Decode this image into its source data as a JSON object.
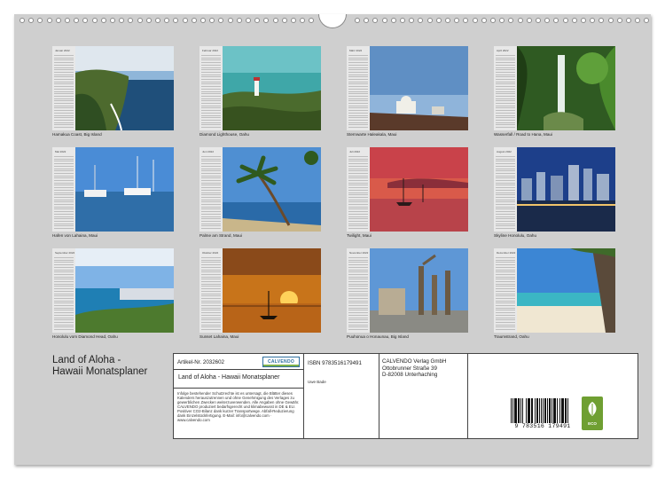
{
  "months": [
    {
      "label": "Januar 2022",
      "caption": "Hamakua Coast, Big Island",
      "scene": "coast"
    },
    {
      "label": "Februar 2022",
      "caption": "Diamond Lighthouse, Oahu",
      "scene": "lighthouse"
    },
    {
      "label": "März 2022",
      "caption": "Sternwarte Haleakala, Maui",
      "scene": "observatory"
    },
    {
      "label": "April 2022",
      "caption": "Wasserfall / Road to Hana, Maui",
      "scene": "waterfall"
    },
    {
      "label": "Mai 2022",
      "caption": "Hafen von Lahaina, Maui",
      "scene": "harbor"
    },
    {
      "label": "Juni 2022",
      "caption": "Palme am Strand, Maui",
      "scene": "palm"
    },
    {
      "label": "Juli 2022",
      "caption": "Twilight, Maui",
      "scene": "twilight"
    },
    {
      "label": "August 2022",
      "caption": "Skyline Honolulu, Oahu",
      "scene": "skyline"
    },
    {
      "label": "September 2022",
      "caption": "Honolulu vom Diamond Head, Oahu",
      "scene": "honolulu"
    },
    {
      "label": "Oktober 2022",
      "caption": "Sunset Lahaina, Maui",
      "scene": "sunset"
    },
    {
      "label": "November 2022",
      "caption": "Puuhonua o Honaunau, Big Island",
      "scene": "tikis"
    },
    {
      "label": "Dezember 2022",
      "caption": "Traumstrand, Oahu",
      "scene": "beach"
    }
  ],
  "title_lines": [
    "Land of Aloha -",
    "Hawaii Monatsplaner"
  ],
  "info": {
    "article": "Artikel-Nr. 2032602",
    "calvendo_logo": "CALVENDO",
    "subtitle": "Land of Aloha - Hawaii Monatsplaner",
    "fine_print": "Infolge bestehender Schutzrechte ist es untersagt, die Blätter dieses Kalenders herauszutrennen und ohne Genehmigung des Verlages zu gewerblichen Zwecken weiterzuverwenden. Alle Angaben ohne Gewähr. CALVENDO produziert bedarfsgerecht und klimabewusst in DE & EU. Positiver CO2-Bilanz dank kurzer Transportwege. Abfall-Reduzierung dank Einzelstückfertigung. E-Mail: info@calvendo.com · www.calvendo.com",
    "isbn": "ISBN 9783516179491",
    "author": "Uwe Bade",
    "publisher_lines": [
      "CALVENDO Verlag GmbH",
      "Ottobrunner Straße 39",
      "D-82008 Unterhaching"
    ],
    "barcode_number": "9 783516 179491",
    "eco_label": "ECO"
  },
  "colors": {
    "sheet": "#cfcfcf",
    "border": "#444444",
    "eco_green": "#6f9f32",
    "calvendo_blue": "#2e6f9e"
  }
}
